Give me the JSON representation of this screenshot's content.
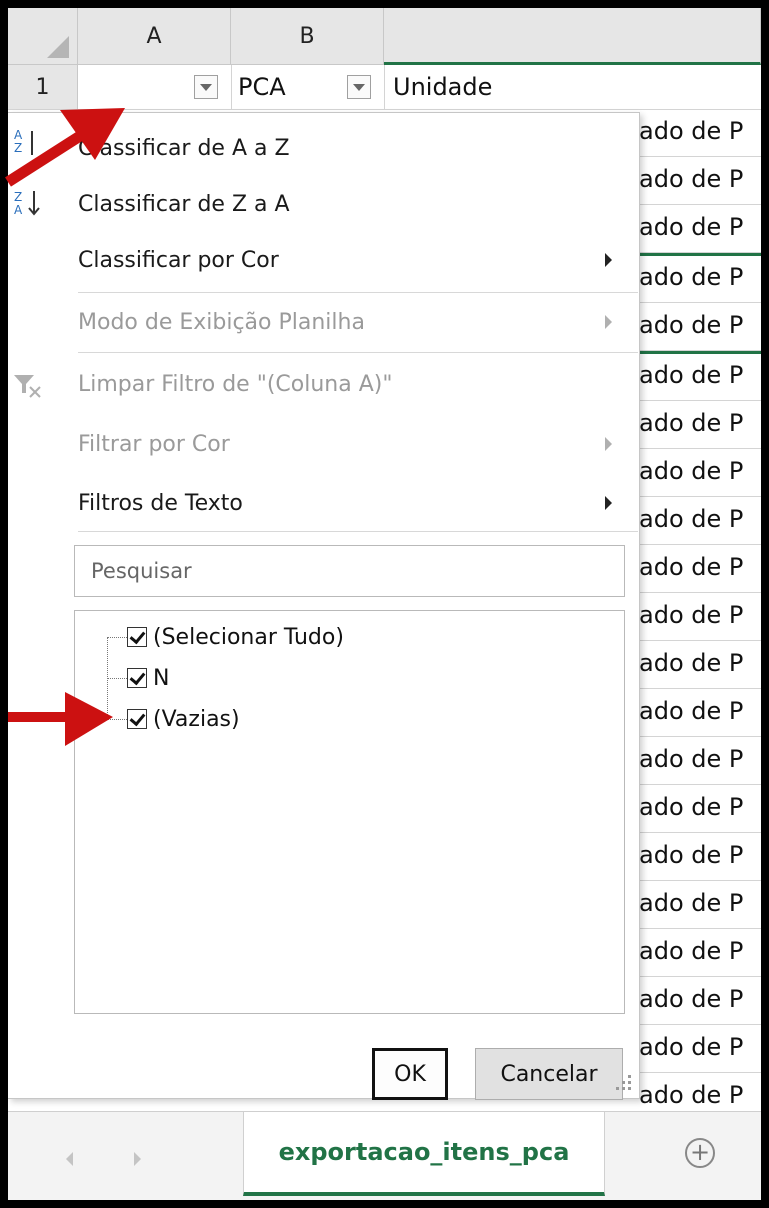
{
  "columns": {
    "a": "A",
    "b": "B"
  },
  "row1": {
    "num": "1",
    "b_header": "PCA",
    "c_header": "Unidade"
  },
  "cell_text": "ado de P",
  "menu": {
    "sort_az": "Classificar de A a Z",
    "sort_za": "Classificar de Z a A",
    "sort_color": "Classificar por Cor",
    "sheet_view": "Modo de Exibição Planilha",
    "clear_filter": "Limpar Filtro de \"(Coluna A)\"",
    "filter_color": "Filtrar por Cor",
    "text_filters": "Filtros de Texto"
  },
  "search": {
    "placeholder": "Pesquisar"
  },
  "list": {
    "select_all": "(Selecionar Tudo)",
    "n": "N",
    "empty": "(Vazias)"
  },
  "buttons": {
    "ok": "OK",
    "cancel": "Cancelar"
  },
  "sheet_tab": "exportacao_itens_pca",
  "colors": {
    "excel_green": "#217346",
    "arrow_red": "#cc1111"
  }
}
